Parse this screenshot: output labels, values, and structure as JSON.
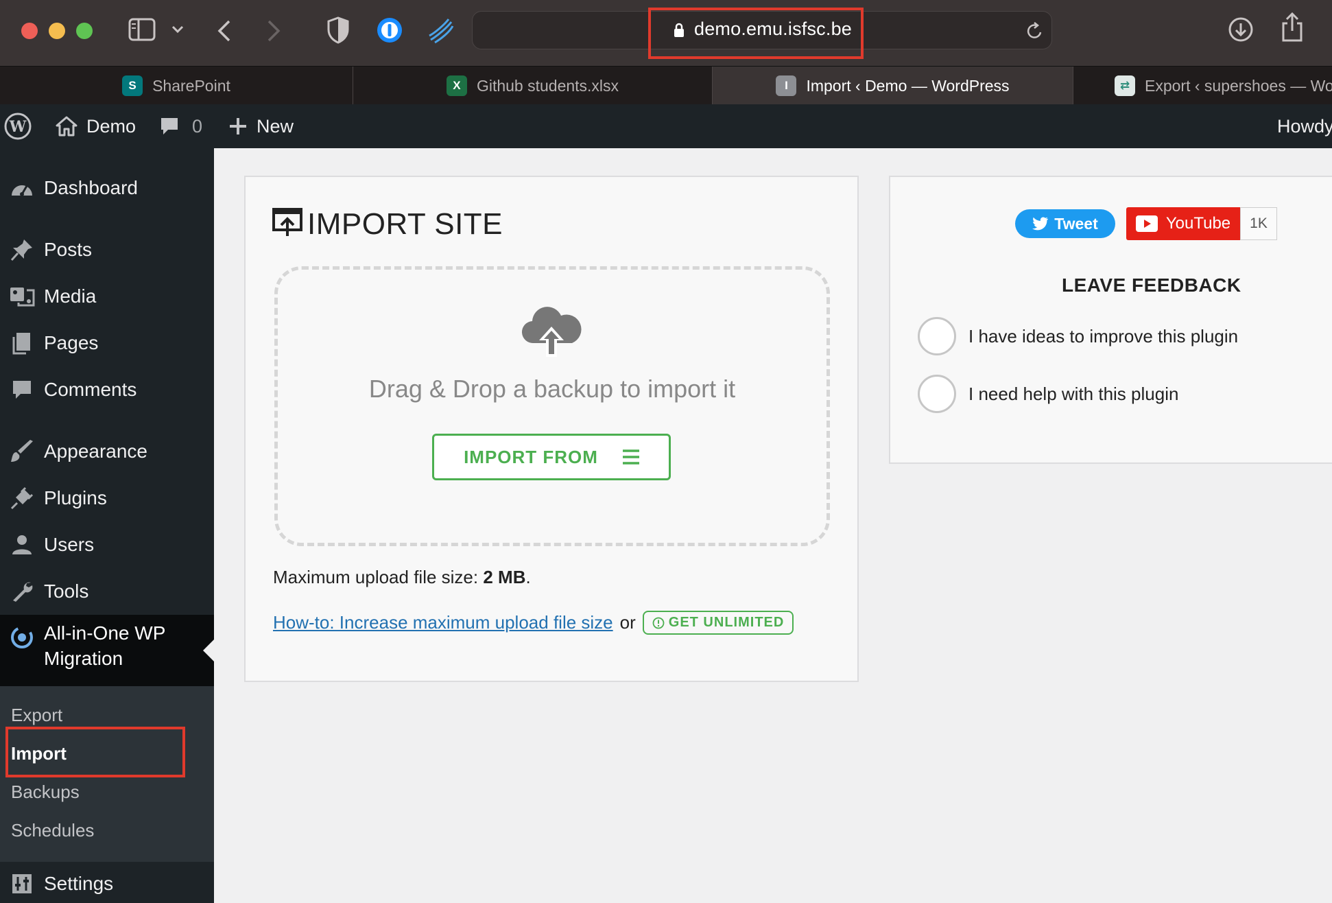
{
  "browser": {
    "url": "demo.emu.isfsc.be",
    "tabs": [
      {
        "label": "SharePoint",
        "favicon": "sharepoint-icon",
        "active": false
      },
      {
        "label": "Github students.xlsx",
        "favicon": "excel-icon",
        "active": false
      },
      {
        "label": "Import ‹ Demo — WordPress",
        "favicon": "wordpress-tab-icon",
        "favicon_text": "I",
        "active": true
      },
      {
        "label": "Export ‹ supershoes — Wo",
        "favicon": "export-icon",
        "active": false
      }
    ]
  },
  "adminbar": {
    "site_name": "Demo",
    "comments_count": "0",
    "new_label": "New",
    "howdy": "Howdy"
  },
  "sidebar": {
    "items": [
      {
        "label": "Dashboard",
        "icon": "dashboard-icon"
      },
      {
        "label": "Posts",
        "icon": "pin-icon"
      },
      {
        "label": "Media",
        "icon": "media-icon"
      },
      {
        "label": "Pages",
        "icon": "pages-icon"
      },
      {
        "label": "Comments",
        "icon": "comment-icon"
      },
      {
        "label": "Appearance",
        "icon": "brush-icon"
      },
      {
        "label": "Plugins",
        "icon": "plug-icon"
      },
      {
        "label": "Users",
        "icon": "user-icon"
      },
      {
        "label": "Tools",
        "icon": "wrench-icon"
      },
      {
        "label": "All-in-One WP",
        "label2": "Migration",
        "icon": "migration-icon"
      },
      {
        "label": "Settings",
        "icon": "settings-icon"
      }
    ],
    "submenu": [
      "Export",
      "Import",
      "Backups",
      "Schedules"
    ],
    "current_sub": "Import"
  },
  "import": {
    "title": "IMPORT SITE",
    "drop_text": "Drag & Drop a backup to import it",
    "button_label": "IMPORT FROM",
    "max_size_label": "Maximum upload file size:",
    "max_size_value": "2 MB",
    "max_size_suffix": ".",
    "howto_link": "How-to: Increase maximum upload file size",
    "or_text": "or",
    "unlimited_label": "GET UNLIMITED"
  },
  "feedback": {
    "tweet_label": "Tweet",
    "youtube_label": "YouTube",
    "youtube_count": "1K",
    "title": "LEAVE FEEDBACK",
    "options": [
      "I have ideas to improve this plugin",
      "I need help with this plugin"
    ]
  },
  "colors": {
    "accent_green": "#4caf50",
    "highlight_red": "#e03a2c",
    "wp_dark": "#1d2327",
    "link_blue": "#2271b1"
  }
}
